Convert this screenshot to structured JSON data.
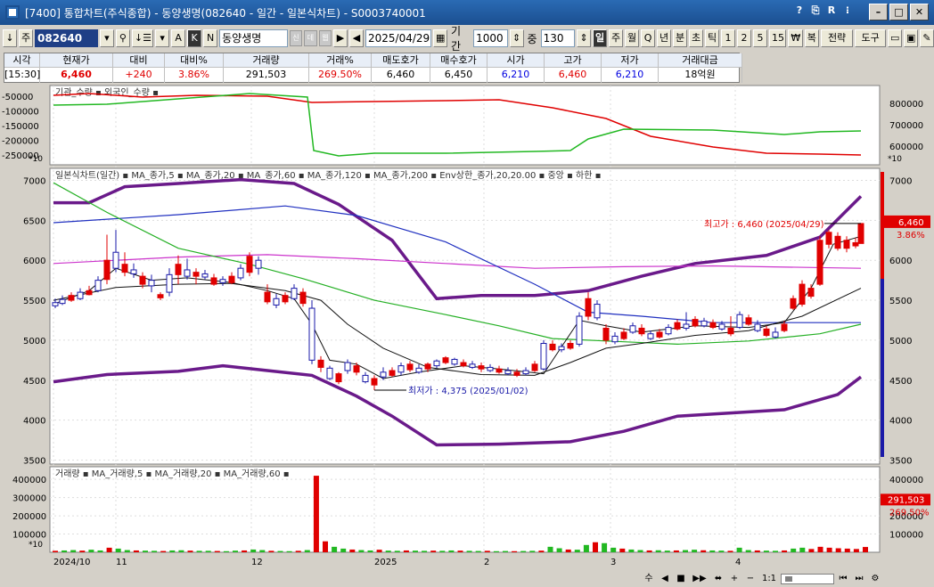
{
  "window": {
    "title": "[7400]  통합차트(주식종합) - 동양생명(082640 - 일간 - 일본식차트) - S0003740001",
    "tools": [
      "?",
      "R",
      "⎘",
      "R",
      "⁝"
    ],
    "minimize": "–",
    "restore": "□",
    "close": "✕"
  },
  "toolbar": {
    "arrow": "↓",
    "market": "주",
    "code": "082640",
    "search_icon": "search-icon",
    "sort": "↓☰",
    "btn_a": "A",
    "btn_k": "K",
    "btn_n": "N",
    "stock_name": "동양생명",
    "nav_next": "▶",
    "nav_prev": "◀",
    "date": "2025/04/29",
    "period_label": "기간",
    "period_value": "1000",
    "unit_label": "중",
    "unit_value": "130",
    "intervals": [
      "일",
      "주",
      "월",
      "Q",
      "년",
      "분",
      "초",
      "틱",
      "1",
      "2",
      "5",
      "15"
    ],
    "currency": "₩",
    "multi": "복",
    "strategy": "전략",
    "tools": "도구",
    "small_btns": [
      "신",
      "데",
      "웹"
    ]
  },
  "quote": {
    "headers": [
      "시각",
      "현재가",
      "대비",
      "대비%",
      "거래량",
      "거래%",
      "매도호가",
      "매수호가",
      "시가",
      "고가",
      "저가",
      "거래대금"
    ],
    "values": [
      "[15:30]",
      "6,460",
      "+240",
      "3.86%",
      "291,503",
      "269.50%",
      "6,460",
      "6,450",
      "6,210",
      "6,460",
      "6,210",
      "18억원"
    ]
  },
  "colors": {
    "up": "#e00000",
    "down": "#1a1aa8",
    "ma5": "#111111",
    "ma20": "#1f2fb0",
    "ma60": "#25b025",
    "ma120": "#2030c0",
    "ma200": "#cc33cc",
    "env": "#6a1a8a",
    "inst": "#e00000",
    "foreign": "#22b822"
  },
  "panels": {
    "investor": {
      "legend": [
        "기관_수량",
        "외국인_수량"
      ],
      "left_ticks": [
        "-50000",
        "-100000",
        "-150000",
        "-200000",
        "-250000"
      ],
      "right_ticks": [
        "800000",
        "700000",
        "600000"
      ],
      "scale_tag": "*10",
      "right_tag": "*10"
    },
    "price": {
      "legend": "일본식차트(일간) ▪ MA_종가,5 ▪ MA_종가,20 ▪ MA_종가,60 ▪ MA_종가,120 ▪ MA_종가,200 ▪ Env상한_종가,20,20.00 ▪ 중앙 ▪ 하한 ▪",
      "ticks": [
        "7000",
        "6500",
        "6000",
        "5500",
        "5000",
        "4500",
        "4000",
        "3500"
      ],
      "high_label": "최고가 : 6,460 (2025/04/29)",
      "low_label": "최저가 : 4,375 (2025/01/02)",
      "current_price": "6,460",
      "current_pct": "3.86%"
    },
    "volume": {
      "legend": "거래량 ▪ MA_거래량,5 ▪ MA_거래량,20 ▪ MA_거래량,60 ▪",
      "ticks": [
        "400000",
        "300000",
        "200000",
        "100000"
      ],
      "scale_tag": "*10",
      "current_volume": "291,503",
      "current_pct": "269.50%"
    },
    "xaxis": [
      "2024/10",
      "11",
      "12",
      "2025",
      "2",
      "3",
      "4"
    ]
  },
  "bottombar": {
    "labels": [
      "수",
      "◀",
      "■",
      "▶▶",
      "⬌",
      "+",
      "−",
      "1:1"
    ]
  }
}
